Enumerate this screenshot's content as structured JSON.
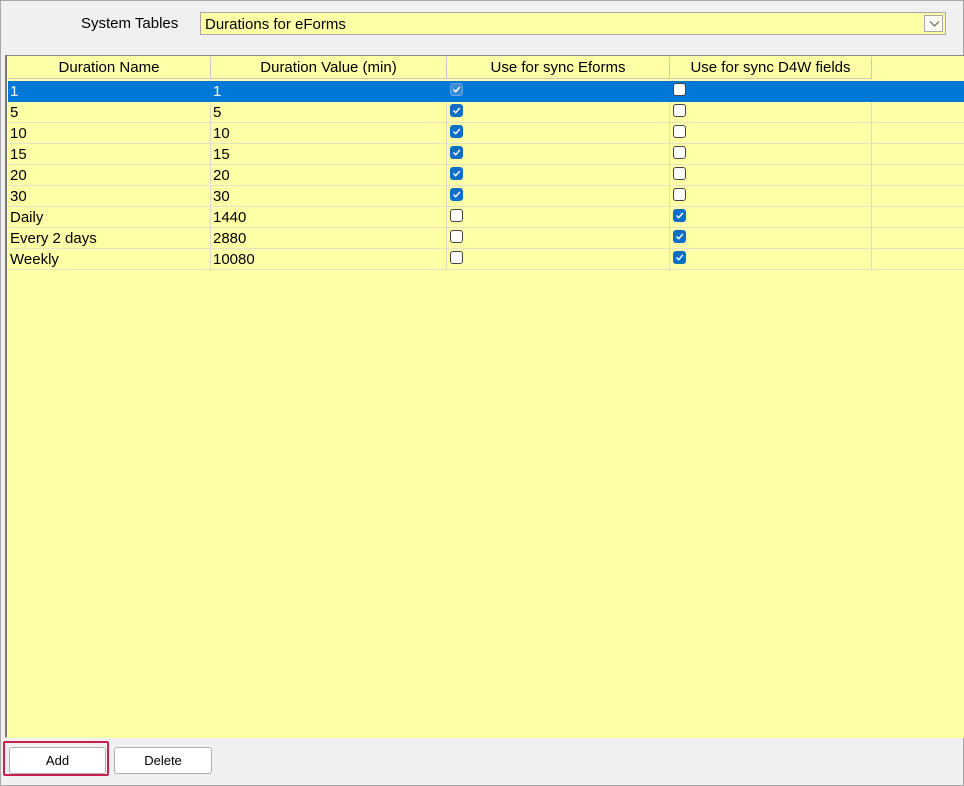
{
  "header": {
    "label": "System Tables",
    "selected": "Durations for eForms"
  },
  "grid": {
    "columns": [
      "Duration Name",
      "Duration Value (min)",
      "Use for sync Eforms",
      "Use for sync D4W fields"
    ],
    "rows": [
      {
        "name": "1",
        "value": "1",
        "eforms": true,
        "d4w": false,
        "selected": true
      },
      {
        "name": "5",
        "value": "5",
        "eforms": true,
        "d4w": false
      },
      {
        "name": "10",
        "value": "10",
        "eforms": true,
        "d4w": false
      },
      {
        "name": "15",
        "value": "15",
        "eforms": true,
        "d4w": false
      },
      {
        "name": "20",
        "value": "20",
        "eforms": true,
        "d4w": false
      },
      {
        "name": "30",
        "value": "30",
        "eforms": true,
        "d4w": false
      },
      {
        "name": "Daily",
        "value": "1440",
        "eforms": false,
        "d4w": true
      },
      {
        "name": "Every 2 days",
        "value": "2880",
        "eforms": false,
        "d4w": true
      },
      {
        "name": "Weekly",
        "value": "10080",
        "eforms": false,
        "d4w": true
      }
    ]
  },
  "buttons": {
    "add": "Add",
    "delete": "Delete"
  },
  "colors": {
    "grid_background": "#ffffa8",
    "selection": "#0078d7",
    "checkbox_checked": "#0e6fc9",
    "focus_ring": "#c8204e"
  }
}
